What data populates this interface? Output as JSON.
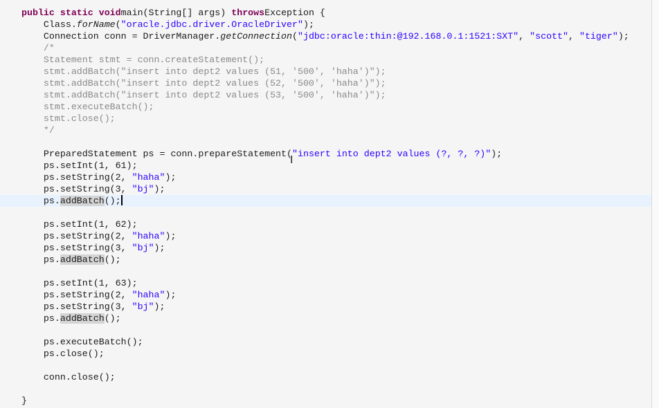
{
  "editor": {
    "current_line": 16,
    "colors": {
      "keyword": "#7f0055",
      "string": "#2a00ff",
      "comment": "#8a8a8a",
      "current_line": "#e8f2fe",
      "occurrence": "#d4d4d4"
    },
    "lines": [
      [
        [
          "kw",
          "public static void"
        ],
        [
          "",
          "main(String[] args) "
        ],
        [
          "kw",
          "throws"
        ],
        [
          "",
          "Exception {"
        ]
      ],
      [
        [
          "",
          "    Class."
        ],
        [
          "it",
          "forName"
        ],
        [
          "",
          "("
        ],
        [
          "str",
          "\"oracle.jdbc.driver.OracleDriver\""
        ],
        [
          "",
          ");"
        ]
      ],
      [
        [
          "",
          "    Connection conn = DriverManager."
        ],
        [
          "it",
          "getConnection"
        ],
        [
          "",
          "("
        ],
        [
          "str",
          "\"jdbc:oracle:thin:@192.168.0.1:1521:SXT\""
        ],
        [
          "",
          ", "
        ],
        [
          "str",
          "\"scott\""
        ],
        [
          "",
          ", "
        ],
        [
          "str",
          "\"tiger\""
        ],
        [
          "",
          ");"
        ]
      ],
      [
        [
          "cm",
          "    /*"
        ]
      ],
      [
        [
          "cm",
          "    Statement stmt = conn.createStatement();"
        ]
      ],
      [
        [
          "cm",
          "    stmt.addBatch(\"insert into dept2 values (51, '500', 'haha')\");"
        ]
      ],
      [
        [
          "cm",
          "    stmt.addBatch(\"insert into dept2 values (52, '500', 'haha')\");"
        ]
      ],
      [
        [
          "cm",
          "    stmt.addBatch(\"insert into dept2 values (53, '500', 'haha')\");"
        ]
      ],
      [
        [
          "cm",
          "    stmt.executeBatch();"
        ]
      ],
      [
        [
          "cm",
          "    stmt.close();"
        ]
      ],
      [
        [
          "cm",
          "    */"
        ]
      ],
      [],
      [
        [
          "",
          "    PreparedStatement ps = conn.prepareStatement("
        ],
        [
          "str",
          "\"insert into dept2 values (?, ?, ?)\""
        ],
        [
          "",
          ");"
        ]
      ],
      [
        [
          "",
          "    ps.setInt(1, 61);"
        ]
      ],
      [
        [
          "",
          "    ps.setString(2, "
        ],
        [
          "str",
          "\"haha\""
        ],
        [
          "",
          ");"
        ]
      ],
      [
        [
          "",
          "    ps.setString(3, "
        ],
        [
          "str",
          "\"bj\""
        ],
        [
          "",
          ");"
        ]
      ],
      [
        [
          "",
          "    ps."
        ],
        [
          "occ",
          "addBatch"
        ],
        [
          "",
          "();"
        ],
        [
          "caret",
          ""
        ]
      ],
      [],
      [
        [
          "",
          "    ps.setInt(1, 62);"
        ]
      ],
      [
        [
          "",
          "    ps.setString(2, "
        ],
        [
          "str",
          "\"haha\""
        ],
        [
          "",
          ");"
        ]
      ],
      [
        [
          "",
          "    ps.setString(3, "
        ],
        [
          "str",
          "\"bj\""
        ],
        [
          "",
          ");"
        ]
      ],
      [
        [
          "",
          "    ps."
        ],
        [
          "occ",
          "addBatch"
        ],
        [
          "",
          "();"
        ]
      ],
      [],
      [
        [
          "",
          "    ps.setInt(1, 63);"
        ]
      ],
      [
        [
          "",
          "    ps.setString(2, "
        ],
        [
          "str",
          "\"haha\""
        ],
        [
          "",
          ");"
        ]
      ],
      [
        [
          "",
          "    ps.setString(3, "
        ],
        [
          "str",
          "\"bj\""
        ],
        [
          "",
          ");"
        ]
      ],
      [
        [
          "",
          "    ps."
        ],
        [
          "occ",
          "addBatch"
        ],
        [
          "",
          "();"
        ]
      ],
      [],
      [
        [
          "",
          "    ps.executeBatch();"
        ]
      ],
      [
        [
          "",
          "    ps.close();"
        ]
      ],
      [],
      [
        [
          "",
          "    conn.close();"
        ]
      ],
      [],
      [
        [
          "",
          "}"
        ]
      ]
    ]
  }
}
